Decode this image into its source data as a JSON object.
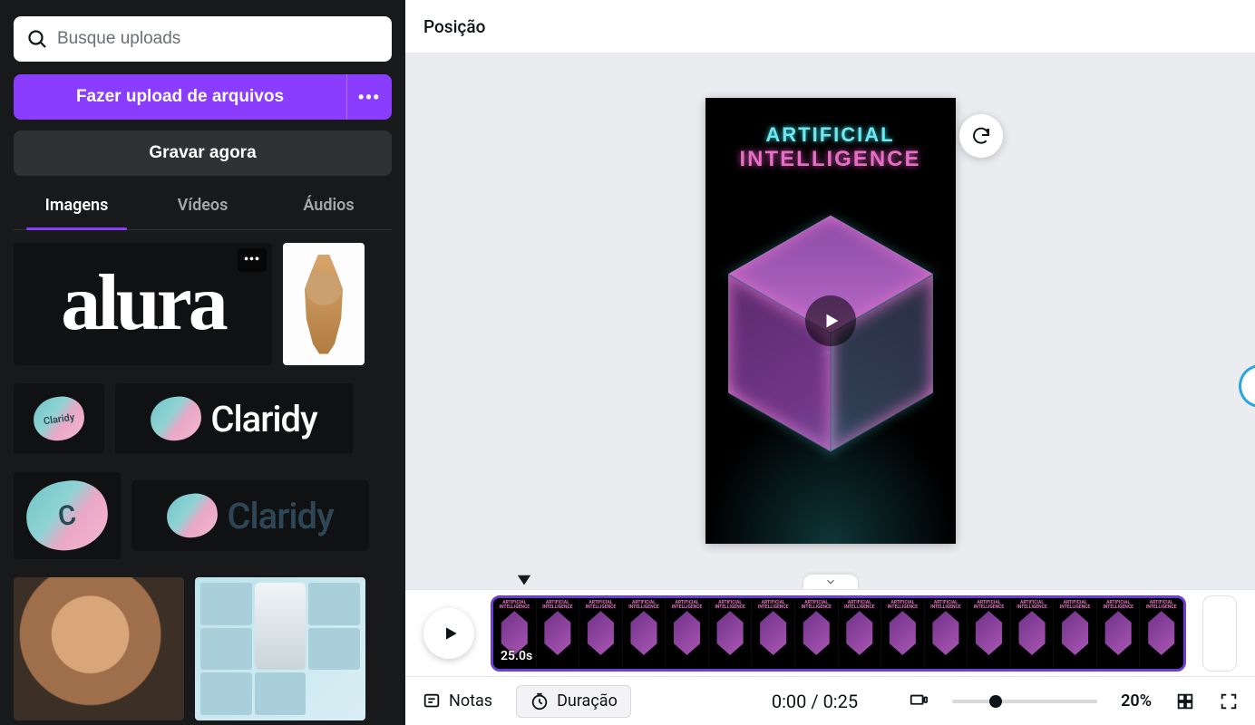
{
  "sidebar": {
    "search_placeholder": "Busque uploads",
    "upload_label": "Fazer upload de arquivos",
    "record_label": "Gravar agora",
    "tabs": [
      {
        "label": "Imagens",
        "active": true
      },
      {
        "label": "Vídeos",
        "active": false
      },
      {
        "label": "Áudios",
        "active": false
      }
    ],
    "uploads": {
      "alura_text": "alura",
      "claridy_small": "Claridy",
      "claridy_big": "Claridy",
      "claridy_dark": "Claridy",
      "c_letter": "C"
    }
  },
  "topbar": {
    "position_label": "Posição"
  },
  "design": {
    "title_line1": "ARTIFICIAL",
    "title_line2": "INTELLIGENCE"
  },
  "timeline": {
    "clip_duration": "25.0s",
    "frame_count": 16
  },
  "bottombar": {
    "notes_label": "Notas",
    "duration_label": "Duração",
    "time_text": "0:00 / 0:25",
    "zoom_text": "20%"
  },
  "colors": {
    "accent": "#8b3dff"
  }
}
